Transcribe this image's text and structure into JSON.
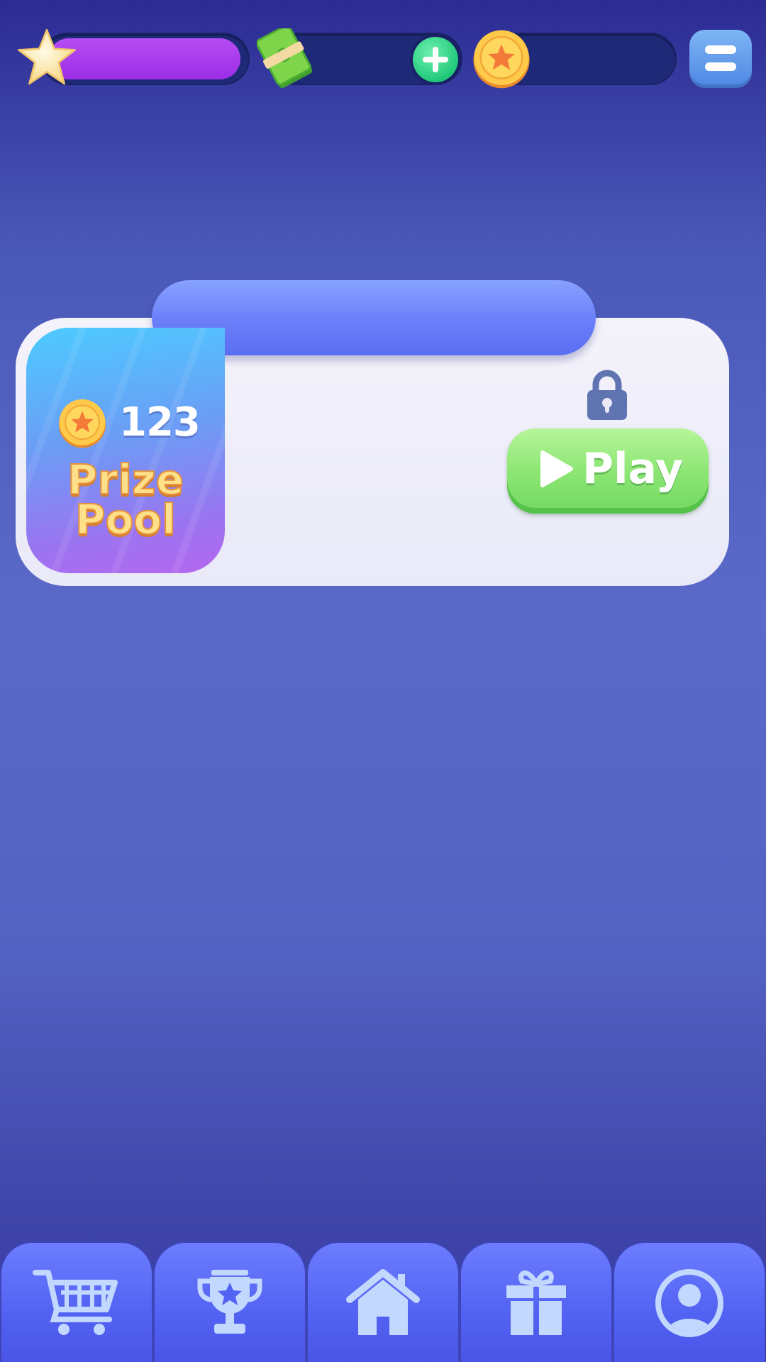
{
  "top_bar": {
    "xp_progress": 0.93,
    "icons": [
      "star-icon",
      "money-icon",
      "plus-icon",
      "coin-icon",
      "menu-icon"
    ]
  },
  "event_card": {
    "prize_amount": "123",
    "prize_label": "Prize Pool",
    "play_label": "Play",
    "locked": true
  },
  "bottom_nav": {
    "tabs": [
      "cart-icon",
      "trophy-icon",
      "home-icon",
      "gift-icon",
      "profile-icon"
    ]
  },
  "colors": {
    "accent_purple": "#9b2ee6",
    "play_green": "#8de674",
    "nav_blue": "#5262f2",
    "gold": "#ffc94a"
  }
}
